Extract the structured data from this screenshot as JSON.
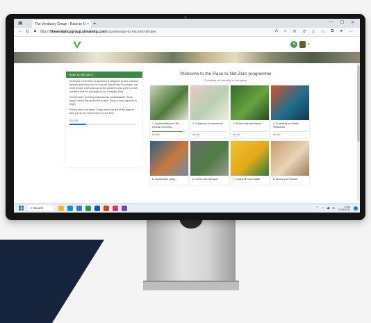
{
  "browser": {
    "tab_title": "The Verdancy Group - Race to N",
    "url_prefix": "https://",
    "url_domain": "theverdancygroup.streamhp.com",
    "url_path": "/courses/race-to-net-zero-j/home",
    "new_tab_symbol": "+",
    "close_symbol": "×"
  },
  "header": {
    "logo_text": "V",
    "notification_count": "5"
  },
  "sidebar": {
    "heading": "Race to Net Zero",
    "paragraphs": [
      "Our Race to Net Zero programme is designed to give practical lessons and resources on how we can all help. As people, we need to take a serious look at the problems and come up with solutions that we can apply to our everyday lives.",
      "Global travel, growing waste and an unsustainable 'throw away' culture has tipped the scales. Press a topic opposite to begin.",
      "Please press the green V logo at the top left of the page to take you to the home screen at any time."
    ],
    "progress_label": "0/10 XP",
    "progress_fraction": 0.25
  },
  "main": {
    "title": "Welcome to the Race to Net Zero programme",
    "subtitle": "Complete all modules in this group"
  },
  "cards": [
    {
      "title": "1. Sustainability and The Circular Economy",
      "badge": "0/3 XP",
      "progress": 0.9,
      "colors": [
        "#c8d2b5",
        "#4d7a3b",
        "#e9e7da"
      ]
    },
    {
      "title": "2. Conscious Consumerism",
      "badge": "0/2 XP",
      "progress": 0.0,
      "colors": [
        "#e9c7c4",
        "#b7d0b0",
        "#f1ece2"
      ]
    },
    {
      "title": "3. Biodiversity and Nature",
      "badge": "0/3 XP",
      "progress": 0.0,
      "colors": [
        "#2e6b2a",
        "#6aa33f",
        "#214d1f"
      ]
    },
    {
      "title": "4. Protecting our Water Resources",
      "badge": "0/3 XP",
      "progress": 0.0,
      "colors": [
        "#d4532a",
        "#1f6f8b",
        "#0d3b4f"
      ]
    },
    {
      "title": "5. Sustainable Living",
      "badge": "",
      "progress": 0.0,
      "colors": [
        "#2b5f8a",
        "#c9793b",
        "#6b8cab"
      ]
    },
    {
      "title": "6. Travel and Transport",
      "badge": "",
      "progress": 0.0,
      "colors": [
        "#6b6b6b",
        "#4f7d43",
        "#9a9a8e"
      ]
    },
    {
      "title": "7. Food and Food Waste",
      "badge": "",
      "progress": 0.0,
      "colors": [
        "#f2c12e",
        "#e0a91b",
        "#2b7a3f"
      ]
    },
    {
      "title": "8. Money and Finance",
      "badge": "",
      "progress": 0.0,
      "colors": [
        "#c79a6b",
        "#e8d5b8",
        "#9b7b5a"
      ]
    }
  ],
  "taskbar": {
    "search_label": "Search",
    "time": "11:48",
    "date": "21/02/2023"
  },
  "colors": {
    "accent_green": "#3d8a47",
    "progress_blue": "#1e73c8"
  }
}
